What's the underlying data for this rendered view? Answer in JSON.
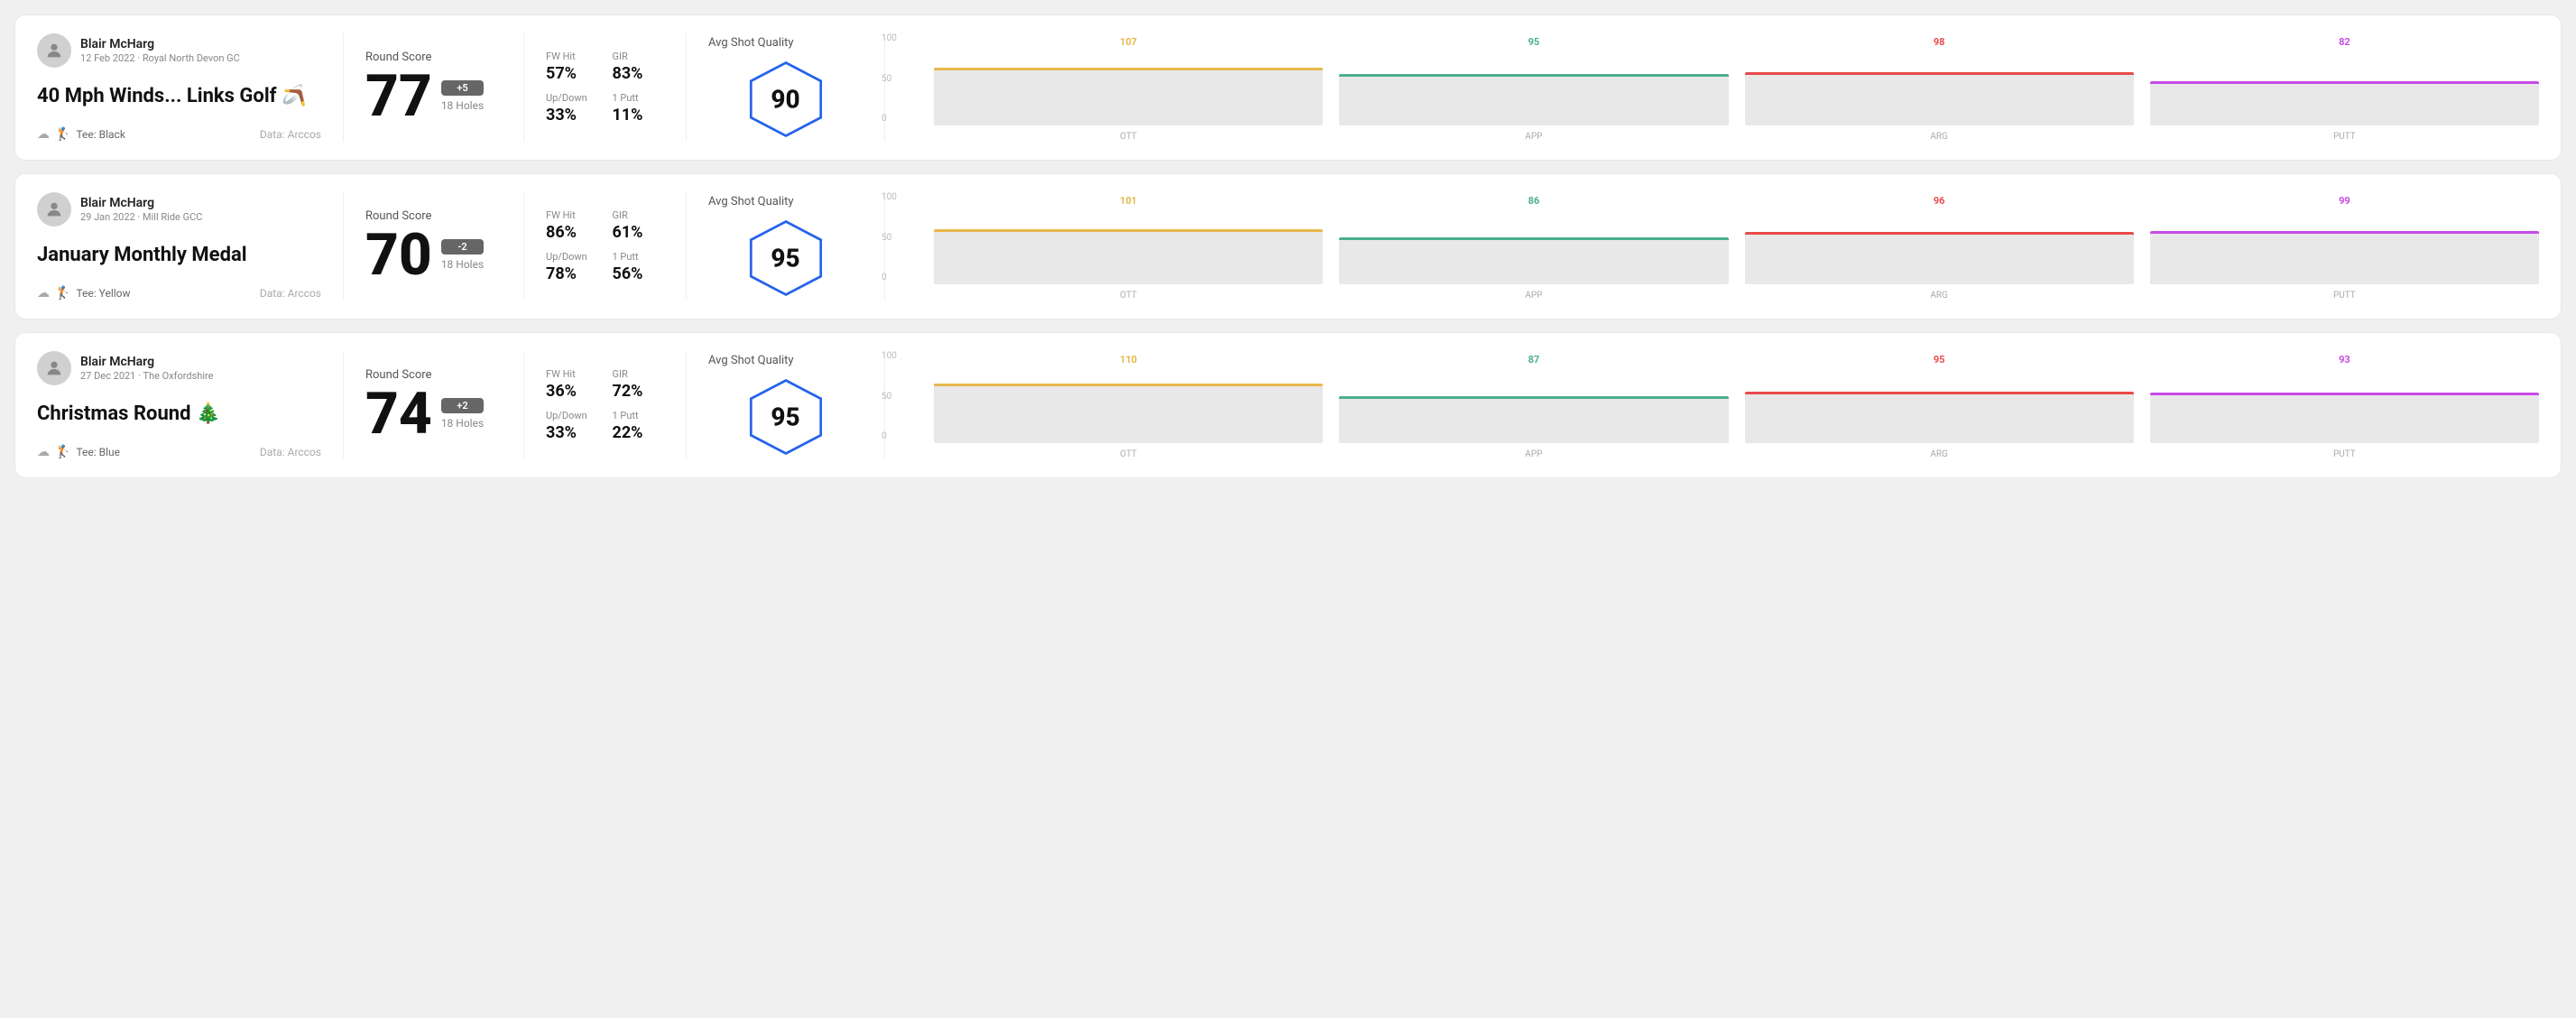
{
  "rounds": [
    {
      "id": "round1",
      "user": {
        "name": "Blair McHarg",
        "meta": "12 Feb 2022 · Royal North Devon GC"
      },
      "title": "40 Mph Winds... Links Golf 🪃",
      "tee": "Black",
      "data_source": "Data: Arccos",
      "score": {
        "label": "Round Score",
        "number": "77",
        "badge": "+5",
        "badge_type": "positive",
        "holes": "18 Holes"
      },
      "stats": [
        {
          "label": "FW Hit",
          "value": "57%"
        },
        {
          "label": "GIR",
          "value": "83%"
        },
        {
          "label": "Up/Down",
          "value": "33%"
        },
        {
          "label": "1 Putt",
          "value": "11%"
        }
      ],
      "quality": {
        "label": "Avg Shot Quality",
        "score": "90"
      },
      "chart": {
        "bars": [
          {
            "label": "OTT",
            "value": 107,
            "max": 120,
            "color": "#e8b84b"
          },
          {
            "label": "APP",
            "value": 95,
            "max": 120,
            "color": "#4caf8c"
          },
          {
            "label": "ARG",
            "value": 98,
            "max": 120,
            "color": "#e84b4b"
          },
          {
            "label": "PUTT",
            "value": 82,
            "max": 120,
            "color": "#c84be8"
          }
        ],
        "y_labels": [
          "100",
          "50",
          "0"
        ]
      }
    },
    {
      "id": "round2",
      "user": {
        "name": "Blair McHarg",
        "meta": "29 Jan 2022 · Mill Ride GCC"
      },
      "title": "January Monthly Medal",
      "tee": "Yellow",
      "data_source": "Data: Arccos",
      "score": {
        "label": "Round Score",
        "number": "70",
        "badge": "-2",
        "badge_type": "negative",
        "holes": "18 Holes"
      },
      "stats": [
        {
          "label": "FW Hit",
          "value": "86%"
        },
        {
          "label": "GIR",
          "value": "61%"
        },
        {
          "label": "Up/Down",
          "value": "78%"
        },
        {
          "label": "1 Putt",
          "value": "56%"
        }
      ],
      "quality": {
        "label": "Avg Shot Quality",
        "score": "95"
      },
      "chart": {
        "bars": [
          {
            "label": "OTT",
            "value": 101,
            "max": 120,
            "color": "#e8b84b"
          },
          {
            "label": "APP",
            "value": 86,
            "max": 120,
            "color": "#4caf8c"
          },
          {
            "label": "ARG",
            "value": 96,
            "max": 120,
            "color": "#e84b4b"
          },
          {
            "label": "PUTT",
            "value": 99,
            "max": 120,
            "color": "#c84be8"
          }
        ],
        "y_labels": [
          "100",
          "50",
          "0"
        ]
      }
    },
    {
      "id": "round3",
      "user": {
        "name": "Blair McHarg",
        "meta": "27 Dec 2021 · The Oxfordshire"
      },
      "title": "Christmas Round 🎄",
      "tee": "Blue",
      "data_source": "Data: Arccos",
      "score": {
        "label": "Round Score",
        "number": "74",
        "badge": "+2",
        "badge_type": "positive",
        "holes": "18 Holes"
      },
      "stats": [
        {
          "label": "FW Hit",
          "value": "36%"
        },
        {
          "label": "GIR",
          "value": "72%"
        },
        {
          "label": "Up/Down",
          "value": "33%"
        },
        {
          "label": "1 Putt",
          "value": "22%"
        }
      ],
      "quality": {
        "label": "Avg Shot Quality",
        "score": "95"
      },
      "chart": {
        "bars": [
          {
            "label": "OTT",
            "value": 110,
            "max": 120,
            "color": "#e8b84b"
          },
          {
            "label": "APP",
            "value": 87,
            "max": 120,
            "color": "#4caf8c"
          },
          {
            "label": "ARG",
            "value": 95,
            "max": 120,
            "color": "#e84b4b"
          },
          {
            "label": "PUTT",
            "value": 93,
            "max": 120,
            "color": "#c84be8"
          }
        ],
        "y_labels": [
          "100",
          "50",
          "0"
        ]
      }
    }
  ]
}
